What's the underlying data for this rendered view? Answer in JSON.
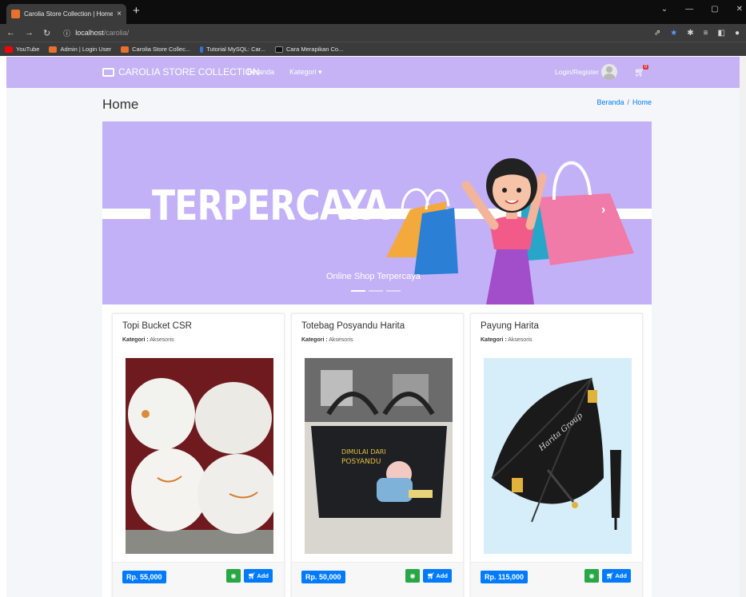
{
  "browser": {
    "tab_title": "Carolia Store Collection | Home",
    "tab_close": "×",
    "new_tab": "+",
    "url_host": "localhost",
    "url_path": "/carolia/",
    "bookmarks": [
      "YouTube",
      "Admin | Login User",
      "Carolia Store Collec...",
      "Tutorial MySQL: Car...",
      "Cara Merapikan Co..."
    ]
  },
  "navbar": {
    "brand": "CAROLIA STORE COLLECTION",
    "links": [
      "Beranda",
      "Kategori ▾"
    ],
    "login": "Login/Register",
    "cart_count": "0"
  },
  "page": {
    "title": "Home",
    "breadcrumb": [
      "Beranda",
      "/",
      "Home"
    ]
  },
  "carousel": {
    "heading": "TERPERCAYA",
    "caption": "Online Shop Terpercaya",
    "slide_count": 3,
    "active_slide": 1
  },
  "products": [
    {
      "name": "Topi Bucket CSR",
      "category_label": "Kategori :",
      "category": "Aksesoris",
      "price": "Rp. 55,000",
      "add_label": "Add"
    },
    {
      "name": "Totebag Posyandu Harita",
      "category_label": "Kategori :",
      "category": "Aksesoris",
      "price": "Rp. 50,000",
      "add_label": "Add"
    },
    {
      "name": "Payung Harita",
      "category_label": "Kategori :",
      "category": "Aksesoris",
      "price": "Rp. 115,000",
      "add_label": "Add"
    }
  ],
  "colors": {
    "navbar": "#c5b3f5",
    "carousel": "#c3b1f8",
    "price_badge": "#007bff",
    "view_button": "#28a745",
    "cart_badge": "#dc3545"
  }
}
